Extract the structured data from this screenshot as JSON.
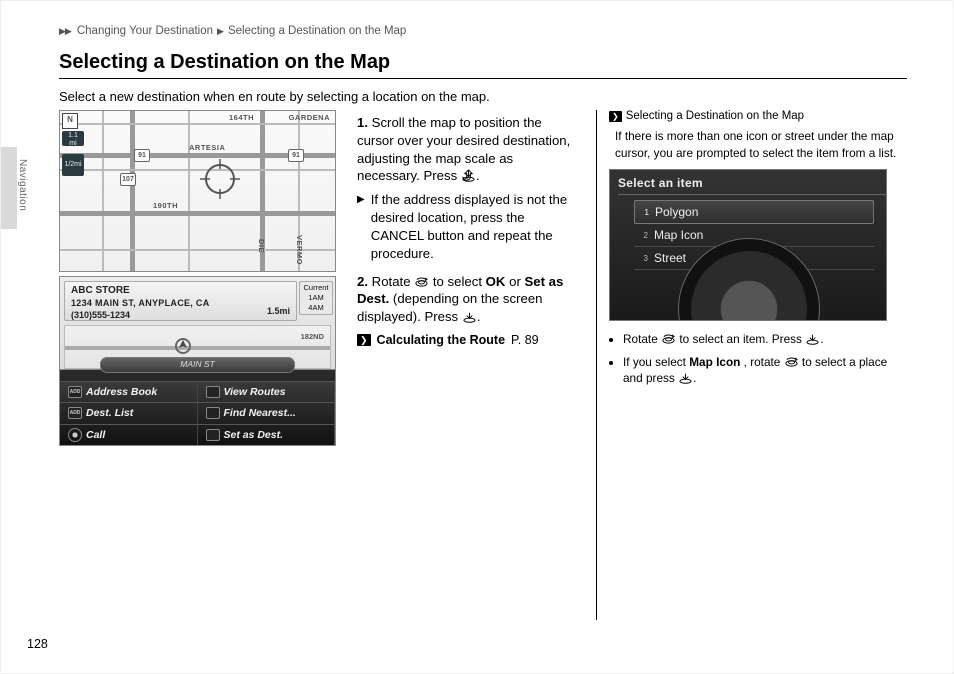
{
  "page_number": "128",
  "side_tab": "Navigation",
  "breadcrumb": {
    "arrows": "▶▶",
    "item1": "Changing Your Destination",
    "sep": "▶",
    "item2": "Selecting a Destination on the Map"
  },
  "title": "Selecting a Destination on the Map",
  "intro": "Select a new destination when en route by selecting a location on the map.",
  "map1": {
    "street_164th": "164TH",
    "street_artesia": "ARTESIA",
    "street_190th": "190TH",
    "street_die": "DIE",
    "street_vermo": "VERMO",
    "area_gardena": "GARDENA",
    "hwy_91_1": "91",
    "hwy_91_2": "91",
    "hwy_107": "107",
    "compass": "N",
    "scale_1": "1.1\nmi",
    "scale_2": "1/2mi"
  },
  "nav": {
    "store": "ABC STORE",
    "addr": "1234 MAIN ST, ANYPLACE, CA",
    "phone": "(310)555-1234",
    "dist": "1.5mi",
    "current": "Current",
    "eta1": "1AM",
    "eta2": "4AM",
    "street_182nd": "182ND",
    "bottom_street": "MAIN ST",
    "menu": {
      "addrbook": "Address Book",
      "viewroutes": "View Routes",
      "destlist": "Dest. List",
      "findnearest": "Find Nearest...",
      "call": "Call",
      "setasdest": "Set as Dest."
    }
  },
  "steps": {
    "s1_num": "1.",
    "s1": "Scroll the map to position the cursor over your desired destination, adjusting the map scale as necessary. Press ",
    "s1_end": ".",
    "s1_sub_tri": "▶",
    "s1_sub": "If the address displayed is not the desired location, press the CANCEL button and repeat the procedure.",
    "s2_num": "2.",
    "s2_a": "Rotate ",
    "s2_b": " to select ",
    "s2_ok": "OK",
    "s2_or": " or ",
    "s2_set": "Set as Dest.",
    "s2_c": " (depending on the screen displayed). Press ",
    "s2_end": ".",
    "link_mark": "❯",
    "link_text": "Calculating the Route",
    "link_page": " P. 89"
  },
  "sidecol": {
    "mark": "❯",
    "title": "Selecting a Destination on the Map",
    "note": "If there is more than one icon or street under the map cursor, you are prompted to select the item from a list.",
    "fig": {
      "header": "Select an item",
      "row1_idx": "1",
      "row1": "Polygon",
      "row2_idx": "2",
      "row2": "Map Icon",
      "row3_idx": "3",
      "row3": "Street"
    },
    "b1_a": "Rotate ",
    "b1_b": " to select an item. Press ",
    "b1_c": ".",
    "b2_a": "If you select ",
    "b2_icon": "Map Icon",
    "b2_b": ", rotate ",
    "b2_c": " to select a place and press ",
    "b2_d": "."
  }
}
